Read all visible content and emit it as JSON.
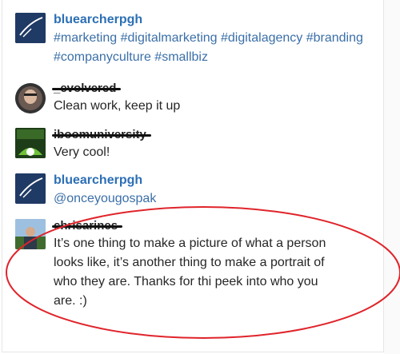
{
  "comments": [
    {
      "username": "bluearcherpgh",
      "text": "#marketing #digitalmarketing #digitalagency #branding #companyculture #smallbiz",
      "type": "hashtags"
    },
    {
      "username": "_evolvered",
      "text": "Clean work, keep it up",
      "type": "redacted"
    },
    {
      "username": "iboomuniversity",
      "text": "Very cool!",
      "type": "redacted"
    },
    {
      "username": "bluearcherpgh",
      "text": "@onceyougospak",
      "type": "mention"
    },
    {
      "username": "chrisarines",
      "text": "It’s one thing to make a picture of what a person looks like, it’s another thing to make a portrait of who they are. Thanks for thi peek into who you are. :)",
      "type": "redacted"
    }
  ],
  "colors": {
    "link": "#2c6fb5",
    "annotation": "#e0242b",
    "logo_bg": "#1f3a64"
  }
}
